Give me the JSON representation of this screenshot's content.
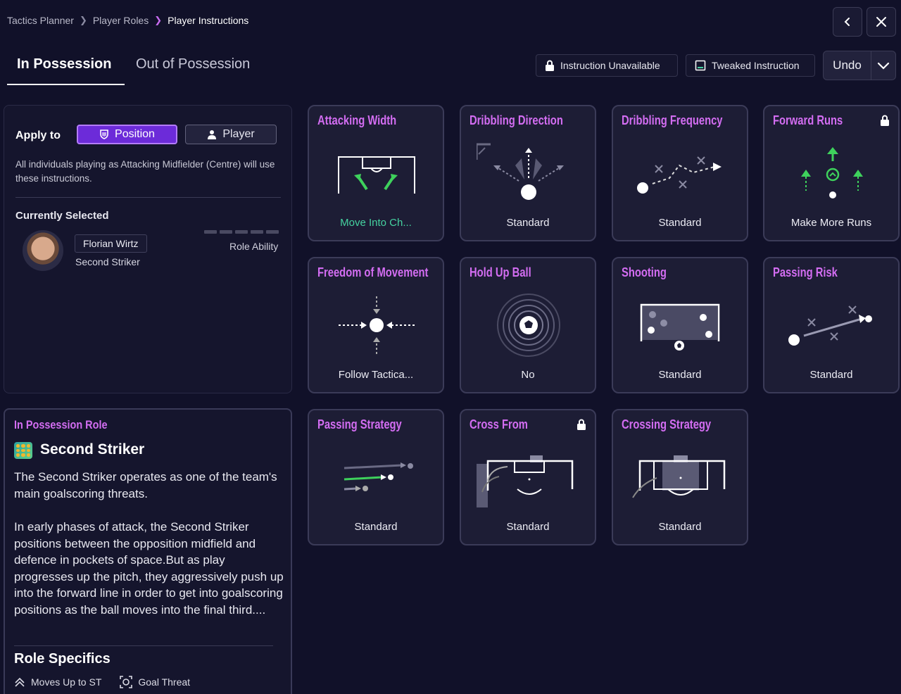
{
  "breadcrumb": {
    "items": [
      "Tactics Planner",
      "Player Roles",
      "Player Instructions"
    ]
  },
  "nav": {
    "back_icon": "chevron-left-icon",
    "close_icon": "close-icon"
  },
  "tabs": {
    "in_possession": "In Possession",
    "out_of_possession": "Out of Possession"
  },
  "legend": {
    "unavailable": "Instruction Unavailable",
    "tweaked": "Tweaked Instruction"
  },
  "undo": {
    "label": "Undo"
  },
  "apply": {
    "label": "Apply to",
    "position": "Position",
    "player": "Player",
    "description": "All individuals playing as Attacking Midfielder (Centre) will use these instructions.",
    "currently_selected": "Currently Selected",
    "player_name": "Florian Wirtz",
    "player_role": "Second Striker",
    "role_ability_label": "Role Ability"
  },
  "role": {
    "header": "In Possession Role",
    "name": "Second Striker",
    "p1": "The Second Striker operates as one of the team's main goalscoring threats.",
    "p2": "In early phases of attack, the Second Striker positions between the opposition midfield and defence in pockets of space.But as play progresses up the pitch, they aggressively push up into the forward line in order to get into goalscoring positions as the ball moves into the final third....",
    "specifics_title": "Role Specifics",
    "specifics": [
      "Moves Up to ST",
      "Goal Threat"
    ]
  },
  "cards": [
    {
      "title": "Attacking Width",
      "value": "Move Into Ch...",
      "tweaked": true,
      "locked": false
    },
    {
      "title": "Dribbling Direction",
      "value": "Standard",
      "locked": false
    },
    {
      "title": "Dribbling Frequency",
      "value": "Standard",
      "locked": false
    },
    {
      "title": "Forward Runs",
      "value": "Make More Runs",
      "locked": true
    },
    {
      "title": "Freedom of Movement",
      "value": "Follow Tactica...",
      "locked": false
    },
    {
      "title": "Hold Up Ball",
      "value": "No",
      "locked": false
    },
    {
      "title": "Shooting",
      "value": "Standard",
      "locked": false
    },
    {
      "title": "Passing Risk",
      "value": "Standard",
      "locked": false
    },
    {
      "title": "Passing Strategy",
      "value": "Standard",
      "locked": false
    },
    {
      "title": "Cross From",
      "value": "Standard",
      "locked": true
    },
    {
      "title": "Crossing Strategy",
      "value": "Standard",
      "locked": false
    }
  ],
  "colors": {
    "accent": "#d36df2",
    "tweaked": "#45d2a0",
    "background": "#111129",
    "card": "#1d1d35"
  }
}
